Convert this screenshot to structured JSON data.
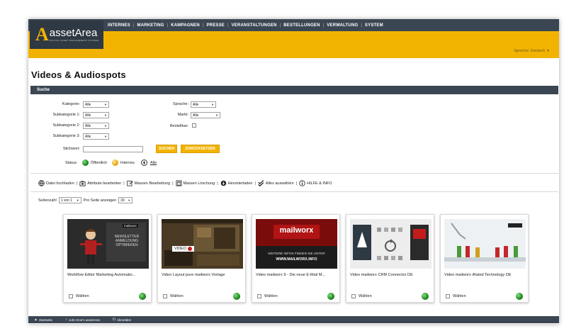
{
  "header": {
    "logo_letter": "A",
    "logo_name": "assetArea",
    "logo_tagline": "DIGITAL ASSET MANAGEMENT SYSTEM",
    "nav": [
      "INTERNES",
      "MARKETING",
      "KAMPAGNEN",
      "PRESSE",
      "VERANSTALTUNGEN",
      "BESTELLUNGEN",
      "VERWALTUNG",
      "SYSTEM"
    ],
    "language_label": "Sprache: Deutsch"
  },
  "page": {
    "title": "Videos & Audiospots"
  },
  "search": {
    "section_title": "Suche",
    "kategorie_label": "Kategorie:",
    "subkategorie1_label": "Subkategorie 1:",
    "subkategorie2_label": "Subkategorie 2:",
    "subkategorie3_label": "Subkategorie 3:",
    "sprache_label": "Sprache:",
    "markt_label": "Markt:",
    "bestellbar_label": "Bestellbar:",
    "select_value": "Alle",
    "stichwort_label": "Stichwort:",
    "stichwort_value": "",
    "search_button": "SUCHEN",
    "reset_button": "ZURÜCKSETZEN",
    "status_label": "Status:",
    "status_public": "Öffentlich",
    "status_internal": "Internes",
    "status_all": "Alle"
  },
  "toolbar": {
    "upload": "Datei hochladen",
    "edit_attributes": "Attribute bearbeiten",
    "bulk_edit": "Massen Bearbeitung",
    "bulk_delete": "Massen Löschung",
    "download": "Herunterladen",
    "select_all": "Alles auswählen",
    "help": "HILFE & INFO",
    "separator": "|"
  },
  "pager": {
    "page_label": "Seitenzahl",
    "page_value": "1 von 1",
    "per_page_label": "Pro Seite anzeigen",
    "per_page_value": "30"
  },
  "cards": [
    {
      "title": "Workflow Editor Marketing Automatio...",
      "choose": "Wählen"
    },
    {
      "title": "Video Layout pure mailworx Vorlage",
      "choose": "Wählen"
    },
    {
      "title": "Video mailworx 9 - Die neue E-Mail M...",
      "choose": "Wählen"
    },
    {
      "title": "Video mailworx CRM Connector DE",
      "choose": "Wählen"
    },
    {
      "title": "Video mailworx iRated Technology DE",
      "choose": "Wählen"
    }
  ],
  "thumb_text": {
    "mailworx": "mailworx",
    "card1_lines": [
      "NEWSLETTER",
      "ANMELDUNG",
      "OPTIMIEREN"
    ],
    "card2_video": "VIDEO",
    "card3_line1": "WEITERE INFOS FINDEN SIE UNTER",
    "card3_line2": "WWW.MAILWORX.INFO"
  },
  "footer": {
    "home": "Startseite",
    "user": "John Doe's assetArea",
    "logout": "Abmelden"
  },
  "colors": {
    "accent": "#f2b300",
    "navbar": "#3b4653",
    "status_green": "#117a11"
  }
}
